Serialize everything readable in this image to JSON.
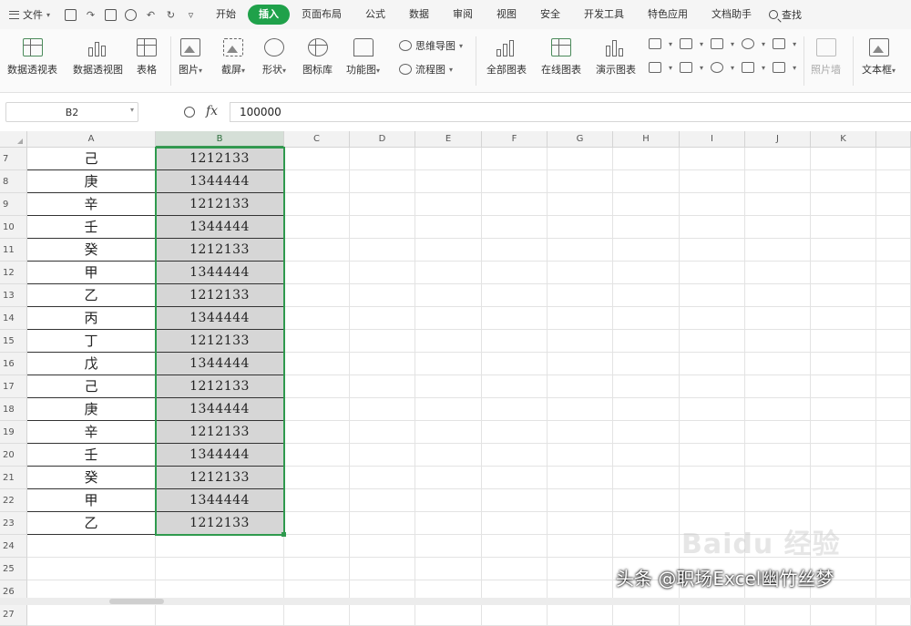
{
  "menu": {
    "file_label": "文件",
    "tabs": [
      "开始",
      "插入",
      "页面布局",
      "公式",
      "数据",
      "审阅",
      "视图",
      "安全",
      "开发工具",
      "特色应用",
      "文档助手"
    ],
    "active_tab": "插入",
    "search_label": "查找"
  },
  "ribbon": {
    "pivot_table": "数据透视表",
    "pivot_chart": "数据透视图",
    "table": "表格",
    "picture": "图片",
    "screenshot": "截屏",
    "shapes": "形状",
    "icon_library": "图标库",
    "function_chart": "功能图",
    "mindmap": "思维导图",
    "flowchart": "流程图",
    "all_charts": "全部图表",
    "online_charts": "在线图表",
    "presentation_charts": "演示图表",
    "attachment": "照片墙",
    "textbox": "文本框"
  },
  "formula_bar": {
    "name_box": "B2",
    "fx": "fx",
    "formula": "100000"
  },
  "columns": [
    "A",
    "B",
    "C",
    "D",
    "E",
    "F",
    "G",
    "H",
    "I",
    "J",
    "K"
  ],
  "selected_column": "B",
  "rows": [
    {
      "n": "7",
      "a": "己",
      "b": "1212133"
    },
    {
      "n": "8",
      "a": "庚",
      "b": "1344444"
    },
    {
      "n": "9",
      "a": "辛",
      "b": "1212133"
    },
    {
      "n": "10",
      "a": "壬",
      "b": "1344444"
    },
    {
      "n": "11",
      "a": "癸",
      "b": "1212133"
    },
    {
      "n": "12",
      "a": "甲",
      "b": "1344444"
    },
    {
      "n": "13",
      "a": "乙",
      "b": "1212133"
    },
    {
      "n": "14",
      "a": "丙",
      "b": "1344444"
    },
    {
      "n": "15",
      "a": "丁",
      "b": "1212133"
    },
    {
      "n": "16",
      "a": "戊",
      "b": "1344444"
    },
    {
      "n": "17",
      "a": "己",
      "b": "1212133"
    },
    {
      "n": "18",
      "a": "庚",
      "b": "1344444"
    },
    {
      "n": "19",
      "a": "辛",
      "b": "1212133"
    },
    {
      "n": "20",
      "a": "壬",
      "b": "1344444"
    },
    {
      "n": "21",
      "a": "癸",
      "b": "1212133"
    },
    {
      "n": "22",
      "a": "甲",
      "b": "1344444"
    },
    {
      "n": "23",
      "a": "乙",
      "b": "1212133"
    },
    {
      "n": "24",
      "a": "",
      "b": ""
    },
    {
      "n": "25",
      "a": "",
      "b": ""
    },
    {
      "n": "26",
      "a": "",
      "b": ""
    },
    {
      "n": "27",
      "a": "",
      "b": ""
    }
  ],
  "watermark": "头条 @职场Excel幽竹丝梦",
  "baidu_mark": "Baidu 经验",
  "colors": {
    "accent": "#1fa14a",
    "selection": "#2f9a4e",
    "selected_fill": "#d6d6d6"
  }
}
